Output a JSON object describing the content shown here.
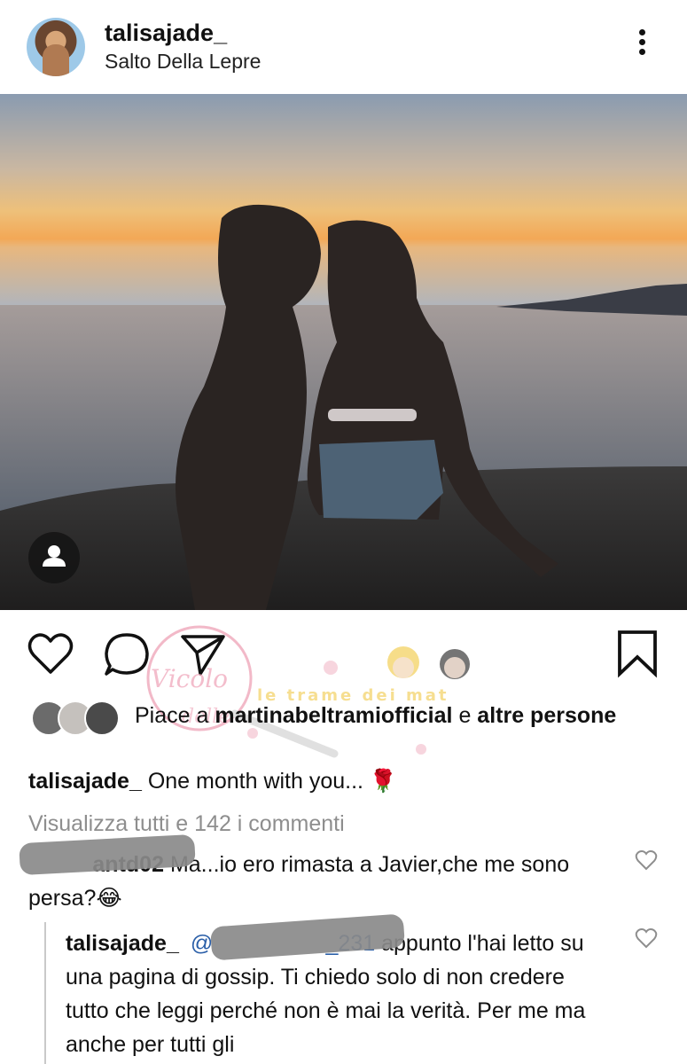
{
  "post": {
    "username": "talisajade_",
    "location": "Salto Della Lepre"
  },
  "icons": {
    "more": "more-vertical-icon",
    "like": "heart-icon",
    "comment": "comment-icon",
    "share": "send-icon",
    "save": "bookmark-icon",
    "tag": "user-tag-icon"
  },
  "likes": {
    "prefix": "Piace a",
    "user": "martinabeltramiofficial",
    "connector": "e",
    "others": "altre persone"
  },
  "caption": {
    "username": "talisajade_",
    "text": "One month with you... 🌹"
  },
  "view_all_comments": "Visualizza tutti e 142 i commenti",
  "comments": [
    {
      "visible_handle_tail": "antd02",
      "text": "Ma...io ero rimasta a Javier,che me sono persa?😂"
    },
    {
      "username": "talisajade_",
      "handle_prefix": "@",
      "handle_tail": "_231",
      "text": "appunto l'hai letto su una pagina di gossip. Ti chiedo solo di non credere tutto che leggi perché non è mai la verità. Per me ma anche per tutti gli"
    }
  ],
  "colors": {
    "text": "#111111",
    "muted": "#8e8e8e",
    "divider": "#c9c9c9"
  }
}
